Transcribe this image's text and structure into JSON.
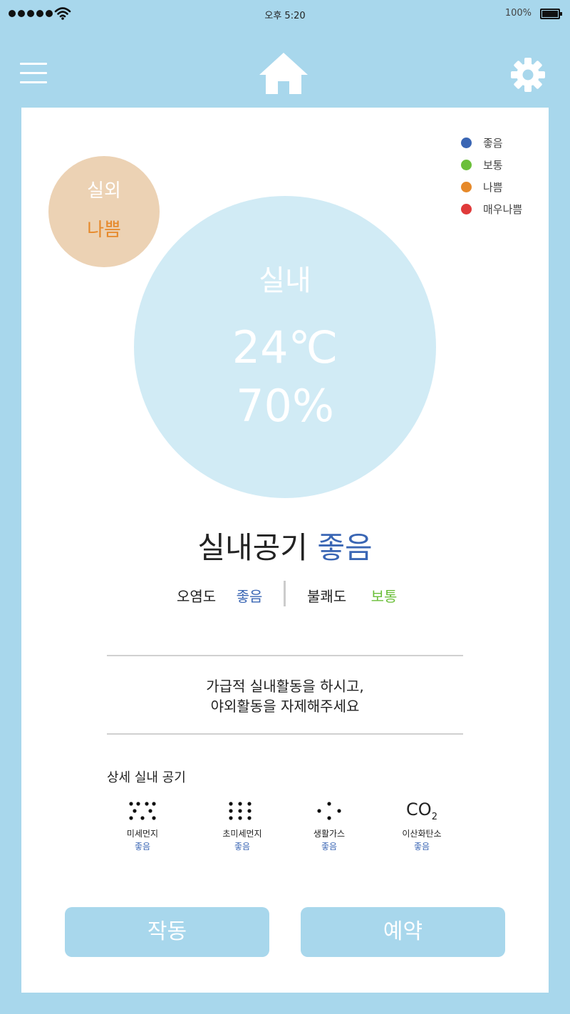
{
  "status_bar": {
    "time": "오후 5:20",
    "battery": "100%"
  },
  "header": {
    "menu_icon": "menu-icon",
    "home_icon": "home-icon",
    "settings_icon": "gear-icon"
  },
  "legend": [
    {
      "label": "좋음",
      "color": "#3a66b4"
    },
    {
      "label": "보통",
      "color": "#6bbf3a"
    },
    {
      "label": "나쁨",
      "color": "#e6892a"
    },
    {
      "label": "매우나쁨",
      "color": "#e03a3a"
    }
  ],
  "outdoor": {
    "title": "실외",
    "status": "나쁨"
  },
  "indoor": {
    "title": "실내",
    "temperature": "24℃",
    "humidity": "70%"
  },
  "air_quality": {
    "label": "실내공기",
    "status": "좋음"
  },
  "pollution": {
    "label": "오염도",
    "value": "좋음"
  },
  "discomfort": {
    "label": "불쾌도",
    "value": "보통"
  },
  "advice": {
    "line1": "가급적 실내활동을 하시고,",
    "line2": "야외활동을 자제해주세요"
  },
  "details": {
    "title": "상세 실내 공기",
    "items": [
      {
        "label": "미세먼지",
        "value": "좋음",
        "icon": "fine-dust-icon"
      },
      {
        "label": "초미세먼지",
        "value": "좋음",
        "icon": "ultrafine-dust-icon"
      },
      {
        "label": "생활가스",
        "value": "좋음",
        "icon": "gas-icon"
      },
      {
        "label": "이산화탄소",
        "value": "좋음",
        "icon": "co2-icon",
        "symbol": "CO",
        "subscript": "2"
      }
    ]
  },
  "buttons": {
    "run": "작동",
    "reserve": "예약"
  }
}
